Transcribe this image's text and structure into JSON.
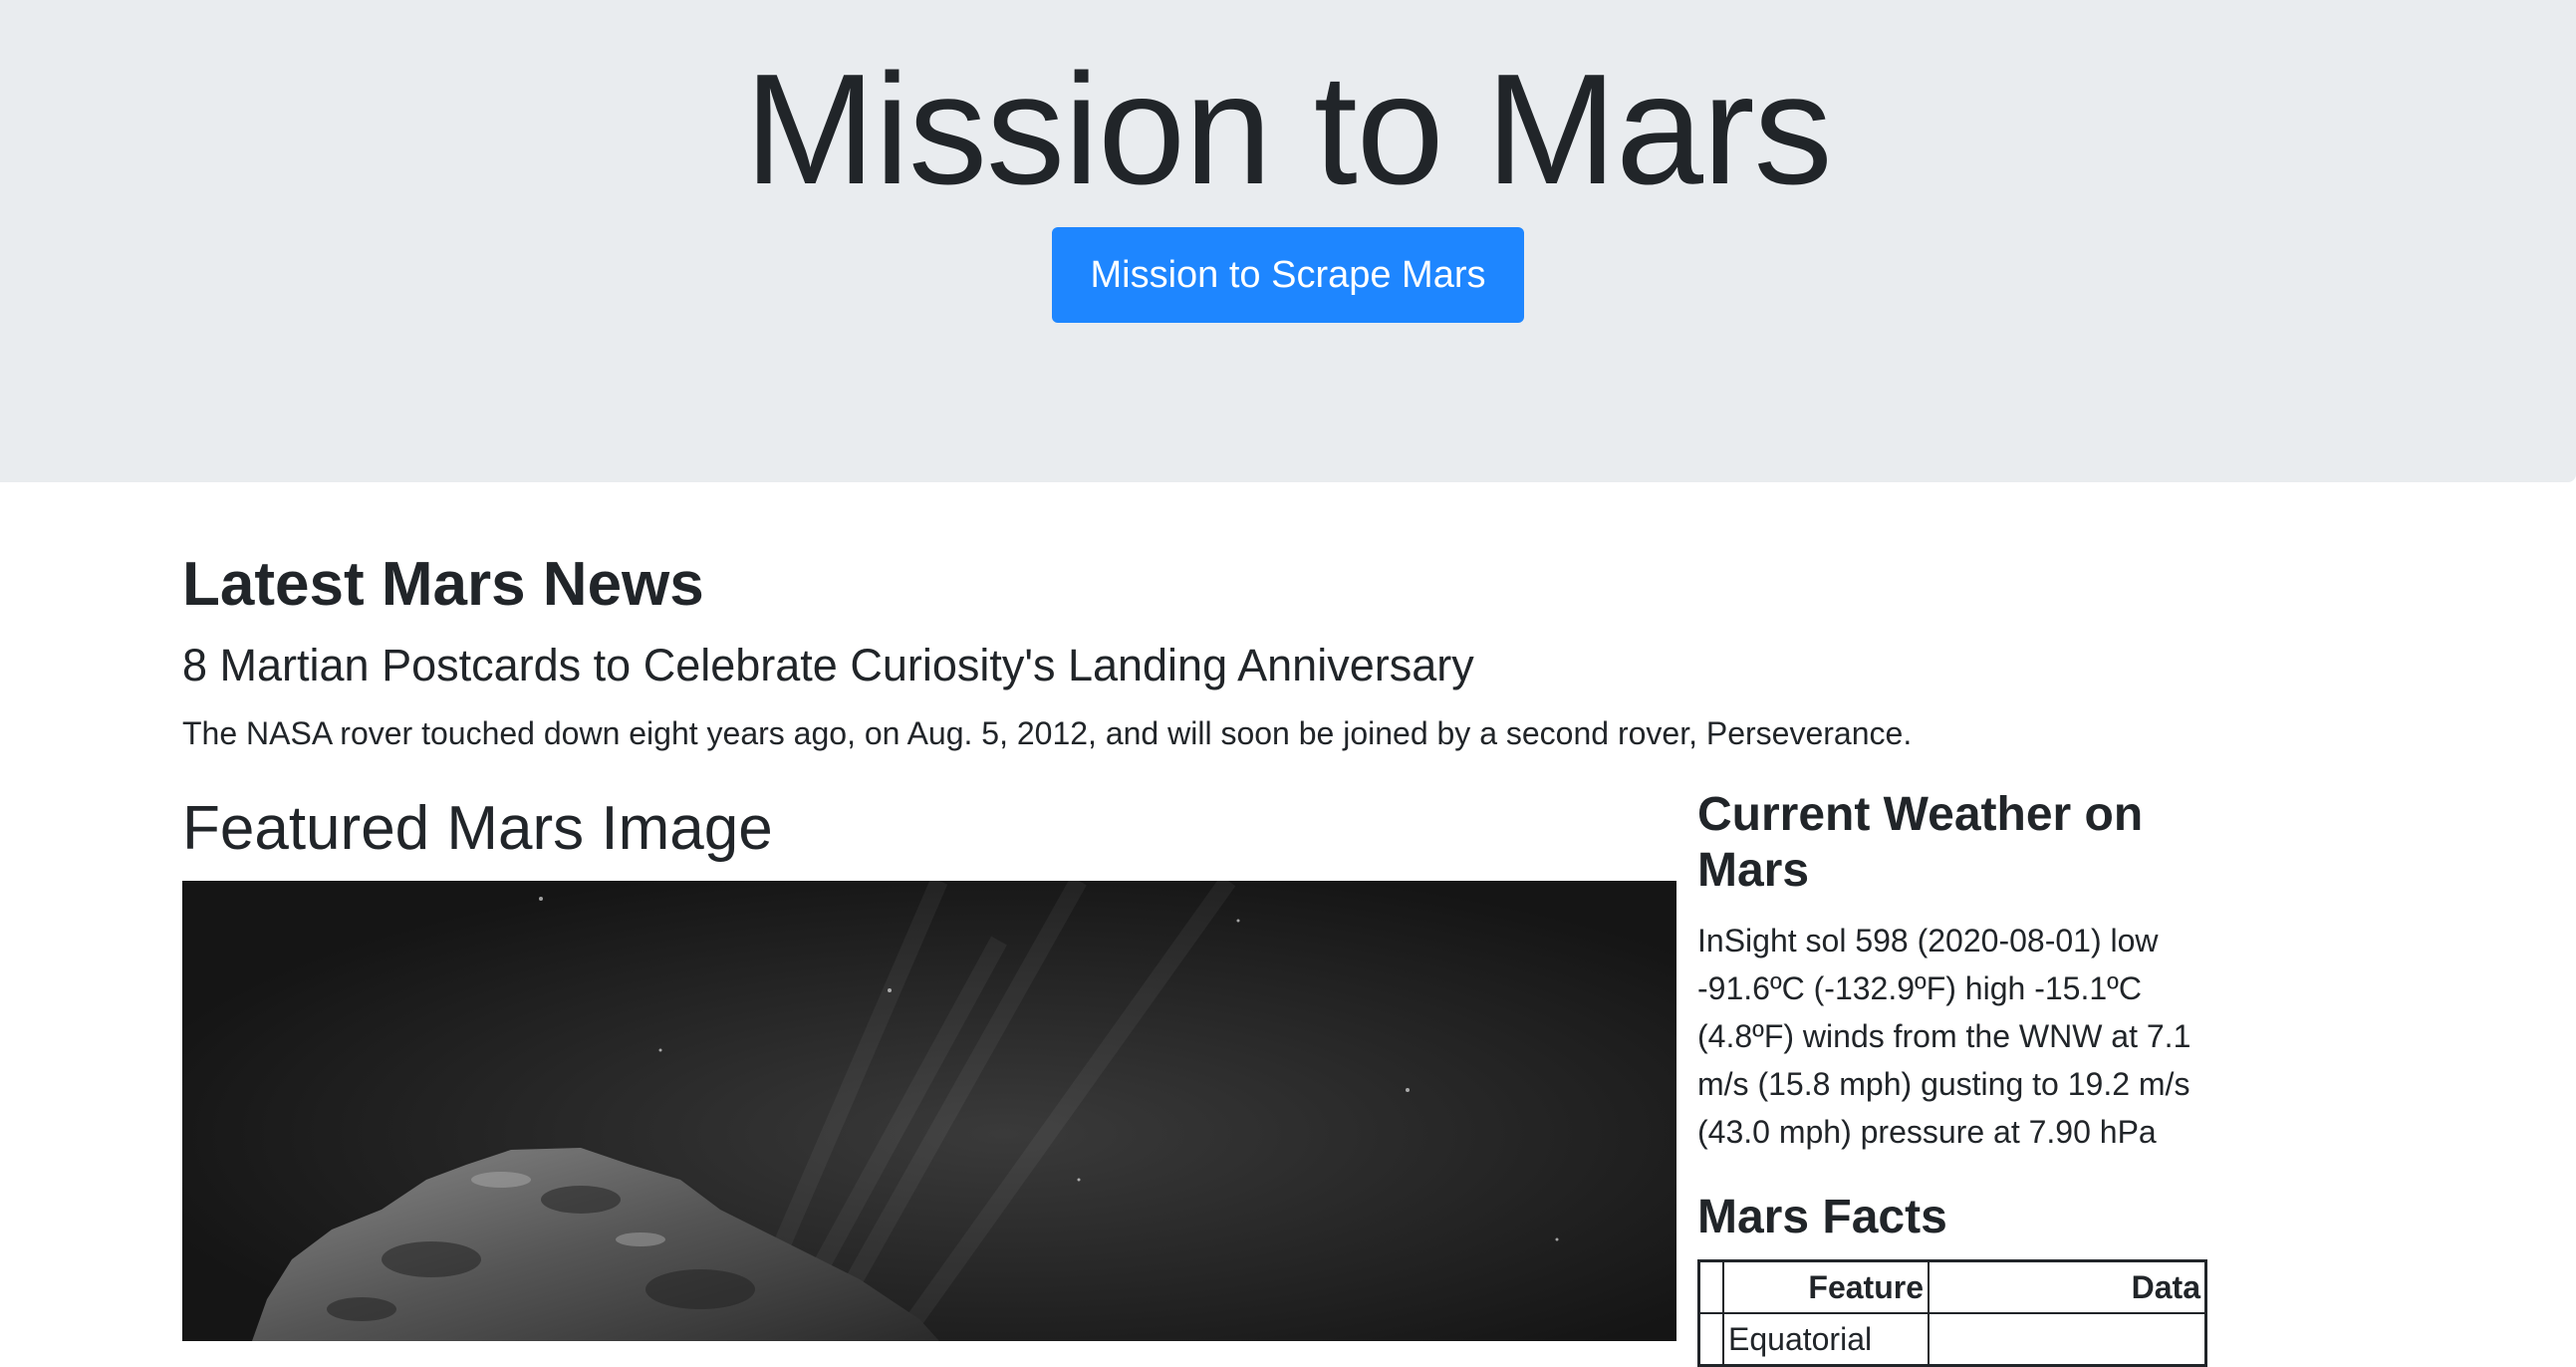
{
  "header": {
    "title": "Mission to Mars",
    "scrape_button_label": "Mission to Scrape Mars"
  },
  "news": {
    "heading": "Latest Mars News",
    "title": "8 Martian Postcards to Celebrate Curiosity's Landing Anniversary",
    "teaser": "The NASA rover touched down eight years ago, on Aug. 5, 2012, and will soon be joined by a second rover, Perseverance."
  },
  "featured": {
    "heading": "Featured Mars Image"
  },
  "weather": {
    "heading": "Current Weather on Mars",
    "text": "InSight sol 598 (2020-08-01) low -91.6ºC (-132.9ºF) high -15.1ºC (4.8ºF) winds from the WNW at 7.1 m/s (15.8 mph) gusting to 19.2 m/s (43.0 mph) pressure at 7.90 hPa"
  },
  "facts": {
    "heading": "Mars Facts",
    "columns": [
      "",
      "Feature",
      "Data"
    ],
    "rows": [
      {
        "index": "",
        "feature": "Equatorial",
        "data": ""
      }
    ]
  },
  "colors": {
    "jumbotron_bg": "#e9ecef",
    "button_primary": "#1e86ff",
    "text": "#212529"
  }
}
